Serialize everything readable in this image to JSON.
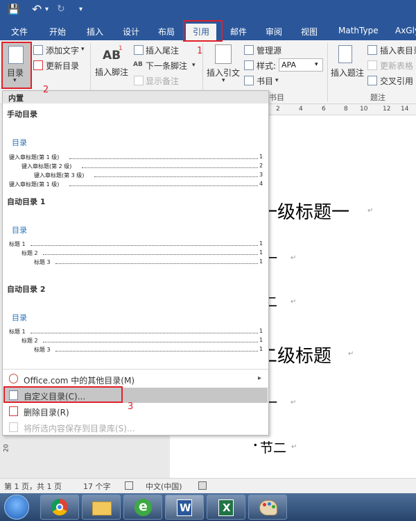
{
  "qat": {
    "save": "💾",
    "undo": "↶",
    "undo_drop": "▾",
    "redo": "↻",
    "customize": "▾"
  },
  "tabs": [
    "文件",
    "开始",
    "插入",
    "设计",
    "布局",
    "引用",
    "邮件",
    "审阅",
    "视图",
    "MathType",
    "AxGly"
  ],
  "ribbon": {
    "toc_label": "目录",
    "toc_drop": "▾",
    "add_text": "添加文字",
    "add_text_drop": "▾",
    "update_toc": "更新目录",
    "footnote_glyph": "AB",
    "footnote_sup": "1",
    "insert_footnote": "插入脚注",
    "insert_endnote": "插入尾注",
    "next_footnote_glyph": "AB",
    "next_footnote": "下一条脚注",
    "next_footnote_drop": "▾",
    "show_notes": "显示备注",
    "insert_citation": "插入引文",
    "insert_citation_drop": "▾",
    "manage_sources": "管理源",
    "style_label": "样式:",
    "style_value": "APA",
    "style_drop": "▾",
    "bibliography": "书目",
    "bibliography_drop": "▾",
    "group_citations_partial": "书目",
    "insert_caption": "插入题注",
    "insert_table_of_figures": "插入表目录",
    "update_table": "更新表格",
    "cross_reference": "交叉引用",
    "group_captions": "题注"
  },
  "annotations": {
    "n1": "1",
    "n2": "2",
    "n3": "3"
  },
  "ruler": [
    "2",
    "4",
    "6",
    "8",
    "10",
    "12",
    "14"
  ],
  "vruler": "20",
  "document": {
    "h1a": "一级标题一",
    "s1": "节一",
    "s2": "节二",
    "h1b": "二级标题",
    "s3": "节一",
    "s4": "节二",
    "para_mark": "↵",
    "bullet": "."
  },
  "dropdown": {
    "header": "内置",
    "manual": {
      "title": "手动目录",
      "toc_title": "目录",
      "lines": [
        {
          "text": "键入章标题(第 1 级)",
          "page": "1"
        },
        {
          "text": "键入章标题(第 2 级)",
          "page": "2"
        },
        {
          "text": "键入章标题(第 3 级)",
          "page": "3"
        },
        {
          "text": "键入章标题(第 1 级)",
          "page": "4"
        }
      ]
    },
    "auto1": {
      "title": "自动目录 1",
      "toc_title": "目录",
      "lines": [
        {
          "text": "标题 1",
          "page": "1"
        },
        {
          "text": "标题 2",
          "page": "1"
        },
        {
          "text": "标题 3",
          "page": "1"
        }
      ]
    },
    "auto2": {
      "title": "自动目录 2",
      "toc_title": "目录",
      "lines": [
        {
          "text": "标题 1",
          "page": "1"
        },
        {
          "text": "标题 2",
          "page": "1"
        },
        {
          "text": "标题 3",
          "page": "1"
        }
      ]
    },
    "menu": {
      "office_more": "Office.com 中的其他目录(M)",
      "office_more_arrow": "▸",
      "custom_toc": "自定义目录(C)...",
      "remove_toc": "删除目录(R)",
      "save_selection": "将所选内容保存到目录库(S)..."
    }
  },
  "status": {
    "page": "第 1 页，共 1 页",
    "words": "17 个字",
    "language": "中文(中国)"
  },
  "taskbar": {
    "word": "W",
    "excel": "X",
    "ie": "e"
  }
}
